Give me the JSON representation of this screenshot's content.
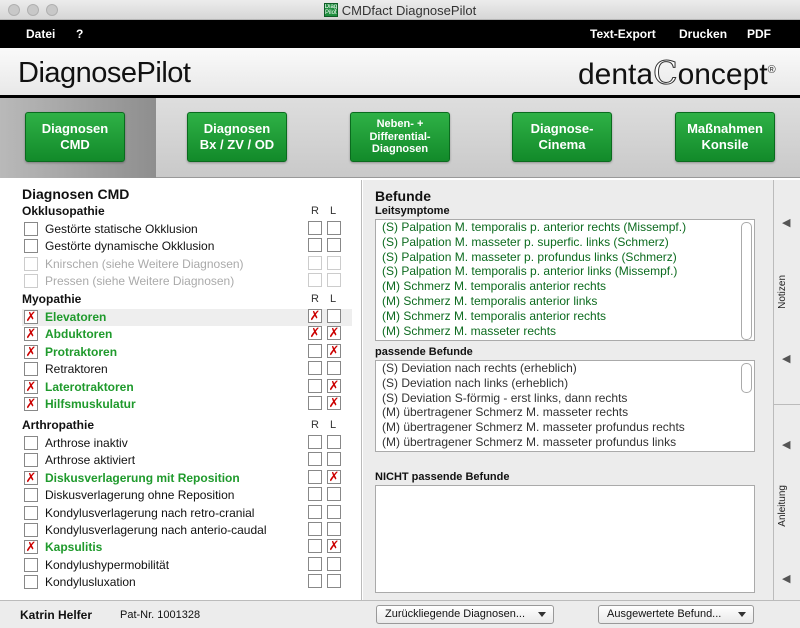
{
  "window": {
    "title": "CMDfact DiagnosePilot",
    "icon_text": "Diagno Pilot"
  },
  "menu": {
    "left": [
      "Datei",
      "?"
    ],
    "right": [
      "Text-Export",
      "Drucken",
      "PDF"
    ]
  },
  "header": {
    "app_logo": "DiagnosePilot",
    "brand_dc_1": "denta",
    "brand_dc_2": "C",
    "brand_dc_3": "oncept",
    "brand_reg": "®"
  },
  "nav": [
    {
      "label": "Diagnosen\nCMD",
      "active": true
    },
    {
      "label": "Diagnosen\nBx / ZV / OD",
      "active": false
    },
    {
      "label": "Neben- +\nDifferential-\nDiagnosen",
      "active": false
    },
    {
      "label": "Diagnose-\nCinema",
      "active": false
    },
    {
      "label": "Maßnahmen\nKonsile",
      "active": false
    }
  ],
  "left": {
    "title": "Diagnosen CMD",
    "col_r": "R",
    "col_l": "L",
    "groups": [
      {
        "title": "Okklusopathie",
        "items": [
          {
            "label": "Gestörte statische Okklusion",
            "checked": false,
            "r": false,
            "l": false,
            "style": "normal"
          },
          {
            "label": "Gestörte dynamische Okklusion",
            "checked": false,
            "r": false,
            "l": false,
            "style": "normal"
          },
          {
            "label": "Knirschen (siehe Weitere Diagnosen)",
            "checked": false,
            "r": false,
            "l": false,
            "style": "disabled"
          },
          {
            "label": "Pressen (siehe Weitere Diagnosen)",
            "checked": false,
            "r": false,
            "l": false,
            "style": "disabled"
          }
        ]
      },
      {
        "title": "Myopathie",
        "items": [
          {
            "label": "Elevatoren",
            "checked": true,
            "r": true,
            "l": false,
            "style": "green"
          },
          {
            "label": "Abduktoren",
            "checked": true,
            "r": true,
            "l": true,
            "style": "green"
          },
          {
            "label": "Protraktoren",
            "checked": true,
            "r": false,
            "l": true,
            "style": "green"
          },
          {
            "label": "Retraktoren",
            "checked": false,
            "r": false,
            "l": false,
            "style": "normal"
          },
          {
            "label": "Laterotraktoren",
            "checked": true,
            "r": false,
            "l": true,
            "style": "green"
          },
          {
            "label": "Hilfsmuskulatur",
            "checked": true,
            "r": false,
            "l": true,
            "style": "green"
          }
        ]
      },
      {
        "title": "Arthropathie",
        "items": [
          {
            "label": "Arthrose inaktiv",
            "checked": false,
            "r": false,
            "l": false,
            "style": "normal"
          },
          {
            "label": "Arthrose aktiviert",
            "checked": false,
            "r": false,
            "l": false,
            "style": "normal"
          },
          {
            "label": "Diskusverlagerung mit Reposition",
            "checked": true,
            "r": false,
            "l": true,
            "style": "green"
          },
          {
            "label": "Diskusverlagerung ohne Reposition",
            "checked": false,
            "r": false,
            "l": false,
            "style": "normal"
          },
          {
            "label": "Kondylusverlagerung nach retro-cranial",
            "checked": false,
            "r": false,
            "l": false,
            "style": "normal"
          },
          {
            "label": "Kondylusverlagerung nach anterio-caudal",
            "checked": false,
            "r": false,
            "l": false,
            "style": "normal"
          },
          {
            "label": "Kapsulitis",
            "checked": true,
            "r": false,
            "l": true,
            "style": "green"
          },
          {
            "label": "Kondylushypermobilität",
            "checked": false,
            "r": false,
            "l": false,
            "style": "normal"
          },
          {
            "label": "Kondylusluxation",
            "checked": false,
            "r": false,
            "l": false,
            "style": "normal"
          }
        ]
      }
    ]
  },
  "befunde": {
    "title": "Befunde",
    "leitsymptome_title": "Leitsymptome",
    "leitsymptome": [
      "(S) Palpation M. temporalis p. anterior rechts (Missempf.)",
      "(S) Palpation M. masseter p. superfic. links (Schmerz)",
      "(S) Palpation M. masseter p. profundus links (Schmerz)",
      "(S) Palpation M. temporalis p. anterior links (Missempf.)",
      "(M) Schmerz M. temporalis anterior rechts",
      "(M) Schmerz M. temporalis anterior links",
      "(M) Schmerz M. temporalis anterior rechts",
      "(M) Schmerz M. masseter rechts"
    ],
    "passende_title": "passende Befunde",
    "passende": [
      "(S) Deviation nach rechts (erheblich)",
      "(S) Deviation nach links (erheblich)",
      "(S) Deviation S-förmig - erst links, dann rechts",
      "(M) übertragener Schmerz M. masseter rechts",
      "(M) übertragener Schmerz M. masseter profundus rechts",
      "(M) übertragener Schmerz M. masseter profundus links"
    ],
    "nicht_title": "NICHT passende Befunde",
    "nicht": []
  },
  "side": {
    "notizen": "Notizen",
    "anleitung": "Anleitung"
  },
  "status": {
    "patient_name": "Katrin Helfer",
    "patient_nr": "Pat-Nr.  1001328",
    "dropdown1": "Zurückliegende Diagnosen...",
    "dropdown2": "Ausgewertete Befund..."
  },
  "colors": {
    "accent_green": "#1f9a2c",
    "check_red": "#c00000",
    "menubar": "#000000"
  }
}
